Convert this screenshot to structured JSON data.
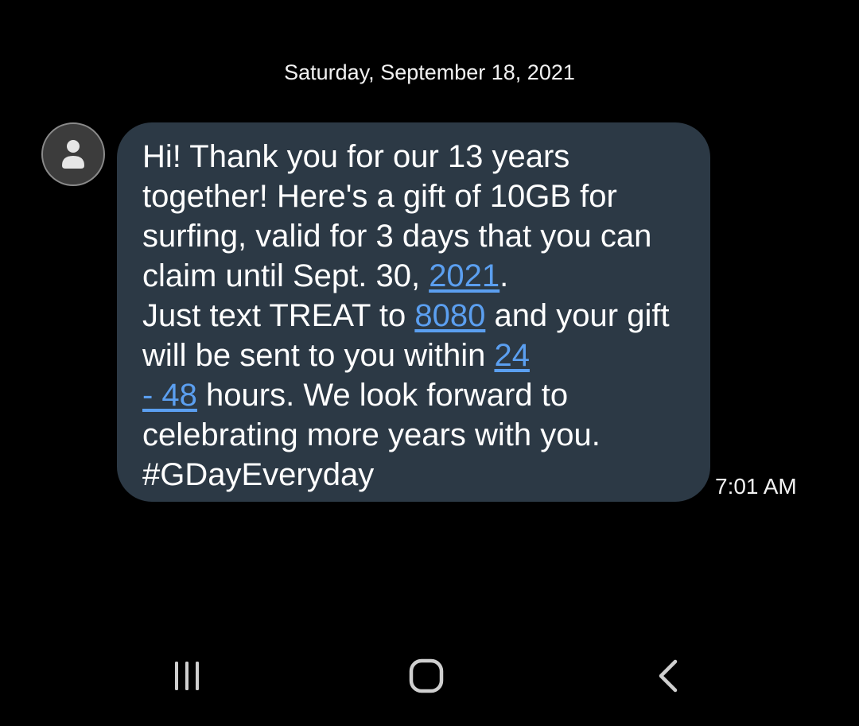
{
  "conversation": {
    "date_header": "Saturday, September 18, 2021",
    "message": {
      "part1": "Hi! Thank you for our 13 years together! Here's a gift of 10GB for surfing, valid for 3 days that you can claim until Sept. 30, ",
      "link_year": "2021",
      "part2": ".\nJust text TREAT to ",
      "link_number": "8080",
      "part3": " and your gift will be sent to you within ",
      "link_hours_a": "24",
      "link_hours_b": "- 48",
      "part4": " hours. We look forward to celebrating more years with you. #GDayEveryday",
      "timestamp": "7:01 AM"
    },
    "avatar_icon": "person-icon"
  },
  "navigation_bar": {
    "recents_icon": "recents-icon",
    "home_icon": "home-icon",
    "back_icon": "back-icon"
  },
  "colors": {
    "background": "#000000",
    "bubble": "#2c3945",
    "link": "#5b9ff0",
    "text": "#ffffff"
  }
}
